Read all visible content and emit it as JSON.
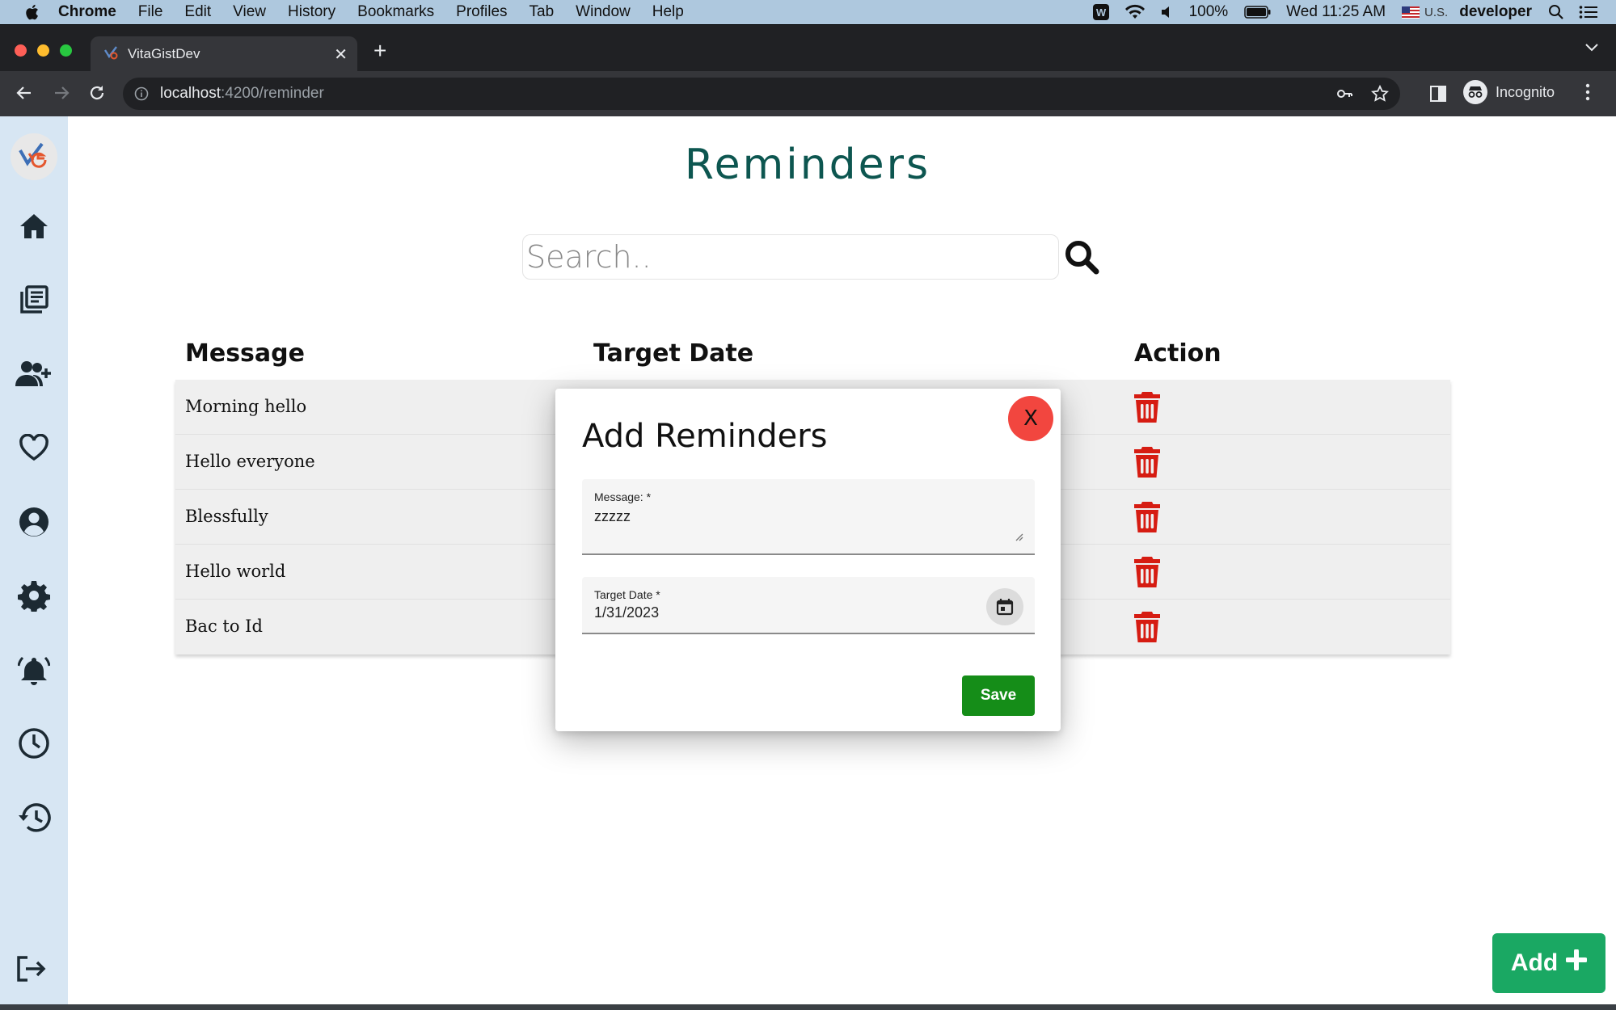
{
  "menubar": {
    "app": "Chrome",
    "items": [
      "File",
      "Edit",
      "View",
      "History",
      "Bookmarks",
      "Profiles",
      "Tab",
      "Window",
      "Help"
    ],
    "battery": "100%",
    "clock": "Wed 11:25 AM",
    "input_source": "U.S.",
    "user": "developer"
  },
  "browser": {
    "tab_title": "VitaGistDev",
    "url_host": "localhost",
    "url_path": ":4200/reminder",
    "profile_label": "Incognito"
  },
  "page": {
    "title": "Reminders",
    "search_placeholder": "Search..",
    "add_button_label": "Add"
  },
  "table": {
    "headers": {
      "message": "Message",
      "target_date": "Target Date",
      "action": "Action"
    },
    "rows": [
      {
        "message": "Morning hello",
        "target_date": ""
      },
      {
        "message": "Hello everyone",
        "target_date": ""
      },
      {
        "message": "Blessfully",
        "target_date": ""
      },
      {
        "message": "Hello world",
        "target_date": ""
      },
      {
        "message": "Bac to Id",
        "target_date": ""
      }
    ]
  },
  "modal": {
    "title": "Add Reminders",
    "close_label": "X",
    "message_label": "Message: *",
    "message_value": "zzzzz",
    "date_label": "Target Date *",
    "date_value": "1/31/2023",
    "save_label": "Save"
  },
  "colors": {
    "title_teal": "#0d5650",
    "sidebar_bg": "#d7e6f3",
    "delete_red": "#d61c12",
    "save_green": "#158d18",
    "add_green": "#1aa863",
    "close_red": "#f2463f"
  },
  "icons": {
    "sidebar": [
      "home-icon",
      "library-icon",
      "add-user-icon",
      "heart-icon",
      "account-icon",
      "settings-icon",
      "alarm-icon",
      "clock-icon",
      "history-icon",
      "logout-icon"
    ]
  }
}
